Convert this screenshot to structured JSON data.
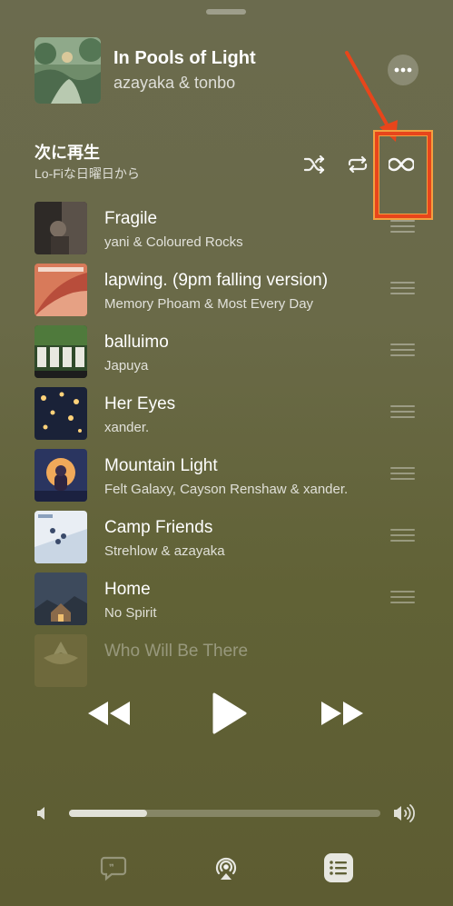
{
  "now_playing": {
    "title": "In Pools of Light",
    "artist": "azayaka & tonbo"
  },
  "up_next": {
    "title": "次に再生",
    "subtitle": "Lo-Fiな日曜日から"
  },
  "queue": [
    {
      "title": "Fragile",
      "artist": "yani & Coloured Rocks"
    },
    {
      "title": "lapwing. (9pm falling version)",
      "artist": "Memory Phoam & Most Every Day"
    },
    {
      "title": "balluimo",
      "artist": "Japuya"
    },
    {
      "title": "Her Eyes",
      "artist": "xander."
    },
    {
      "title": "Mountain Light",
      "artist": "Felt Galaxy, Cayson Renshaw & xander."
    },
    {
      "title": "Camp Friends",
      "artist": "Strehlow & azayaka"
    },
    {
      "title": "Home",
      "artist": "No Spirit"
    },
    {
      "title": "Who Will Be There",
      "artist": ""
    }
  ],
  "volume": {
    "level": 0.25
  },
  "icons": {
    "shuffle": "shuffle-icon",
    "repeat": "repeat-icon",
    "autoplay": "infinity-icon",
    "more": "ellipsis-icon",
    "rewind": "backward-icon",
    "play": "play-icon",
    "forward": "forward-icon",
    "lyrics": "lyrics-icon",
    "airplay": "airplay-icon",
    "queue": "queue-list-icon"
  },
  "colors": {
    "annotation": "#e8451b"
  }
}
